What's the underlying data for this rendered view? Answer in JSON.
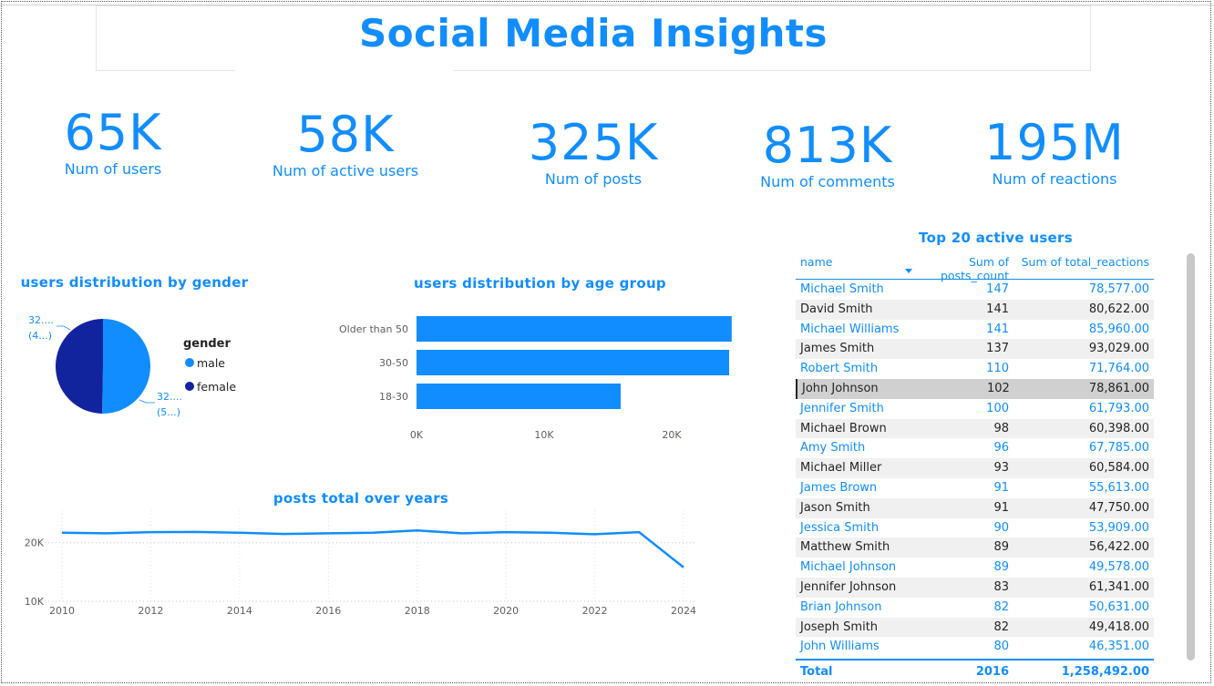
{
  "title": "Social Media Insights",
  "kpis": [
    {
      "value": "65K",
      "label": "Num of users"
    },
    {
      "value": "58K",
      "label": "Num of active users"
    },
    {
      "value": "325K",
      "label": "Num of posts"
    },
    {
      "value": "813K",
      "label": "Num of comments"
    },
    {
      "value": "195M",
      "label": "Num of reactions"
    }
  ],
  "colors": {
    "accent": "#118DFF",
    "dark_blue": "#12239E",
    "selected_row": "#d0d0d0"
  },
  "gender_chart": {
    "title": "users distribution by gender",
    "legend_title": "gender",
    "label_female_line1": "32....",
    "label_female_line2": "(4...)",
    "label_male_line1": "32....",
    "label_male_line2": "(5...)"
  },
  "age_chart": {
    "title": "users distribution by age group"
  },
  "years_chart": {
    "title": "posts total over years"
  },
  "chart_data": [
    {
      "type": "pie",
      "title": "users distribution by gender",
      "legend_title": "gender",
      "categories": [
        "male",
        "female"
      ],
      "values": [
        32700,
        32300
      ],
      "colors": [
        "#118DFF",
        "#12239E"
      ]
    },
    {
      "type": "bar",
      "orientation": "horizontal",
      "title": "users distribution by age group",
      "categories": [
        "Older than 50",
        "30-50",
        "18-30"
      ],
      "values": [
        24700,
        24500,
        16000
      ],
      "xlim": [
        0,
        25000
      ],
      "xticks": [
        "0K",
        "10K",
        "20K"
      ],
      "grid": false
    },
    {
      "type": "line",
      "title": "posts total over years",
      "x": [
        2010,
        2011,
        2012,
        2013,
        2014,
        2015,
        2016,
        2017,
        2018,
        2019,
        2020,
        2021,
        2022,
        2023,
        2024
      ],
      "values": [
        21700,
        21600,
        21800,
        21850,
        21700,
        21500,
        21600,
        21700,
        22100,
        21600,
        21800,
        21700,
        21450,
        21800,
        15800
      ],
      "xticks": [
        "2010",
        "2012",
        "2014",
        "2016",
        "2018",
        "2020",
        "2022",
        "2024"
      ],
      "yticks": [
        "10K",
        "20K"
      ],
      "ylim": [
        10000,
        24000
      ],
      "grid": true
    }
  ],
  "table": {
    "title": "Top 20 active users",
    "columns": [
      "name",
      "Sum of posts_count",
      "Sum of total_reactions"
    ],
    "rows": [
      [
        "Michael Smith",
        "147",
        "78,577.00"
      ],
      [
        "David Smith",
        "141",
        "80,622.00"
      ],
      [
        "Michael Williams",
        "141",
        "85,960.00"
      ],
      [
        "James Smith",
        "137",
        "93,029.00"
      ],
      [
        "Robert Smith",
        "110",
        "71,764.00"
      ],
      [
        "John Johnson",
        "102",
        "78,861.00"
      ],
      [
        "Jennifer Smith",
        "100",
        "61,793.00"
      ],
      [
        "Michael Brown",
        "98",
        "60,398.00"
      ],
      [
        "Amy Smith",
        "96",
        "67,785.00"
      ],
      [
        "Michael Miller",
        "93",
        "60,584.00"
      ],
      [
        "James Brown",
        "91",
        "55,613.00"
      ],
      [
        "Jason Smith",
        "91",
        "47,750.00"
      ],
      [
        "Jessica Smith",
        "90",
        "53,909.00"
      ],
      [
        "Matthew Smith",
        "89",
        "56,422.00"
      ],
      [
        "Michael Johnson",
        "89",
        "49,578.00"
      ],
      [
        "Jennifer Johnson",
        "83",
        "61,341.00"
      ],
      [
        "Brian Johnson",
        "82",
        "50,631.00"
      ],
      [
        "Joseph Smith",
        "82",
        "49,418.00"
      ],
      [
        "John Williams",
        "80",
        "46,351.00"
      ]
    ],
    "selected_row": "John Johnson",
    "total": [
      "Total",
      "2016",
      "1,258,492.00"
    ]
  }
}
